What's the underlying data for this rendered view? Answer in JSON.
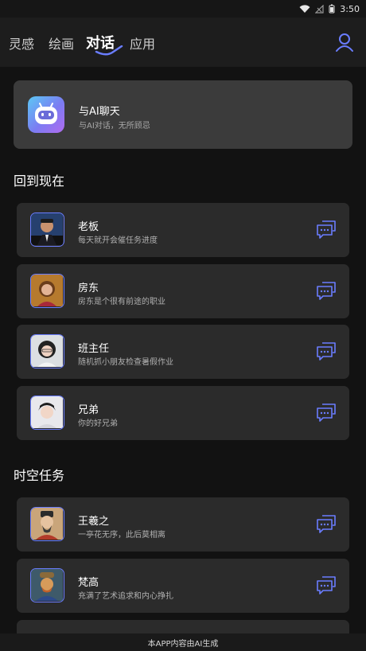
{
  "status_bar": {
    "time": "3:50"
  },
  "nav": {
    "tabs": [
      {
        "label": "灵感"
      },
      {
        "label": "绘画"
      },
      {
        "label": "对话"
      },
      {
        "label": "应用"
      }
    ],
    "active_tab": "对话"
  },
  "hero": {
    "title": "与AI聊天",
    "subtitle": "与AI对话，无所顾忌"
  },
  "sections": [
    {
      "title": "回到现在",
      "items": [
        {
          "name": "老板",
          "desc": "每天就开会催任务进度",
          "avatar": "businessman-portrait"
        },
        {
          "name": "房东",
          "desc": "房东是个很有前途的职业",
          "avatar": "woman-portrait"
        },
        {
          "name": "班主任",
          "desc": "随机抓小朋友检查暑假作业",
          "avatar": "teacher-portrait"
        },
        {
          "name": "兄弟",
          "desc": "你的好兄弟",
          "avatar": "young-man-portrait"
        }
      ]
    },
    {
      "title": "时空任务",
      "items": [
        {
          "name": "王羲之",
          "desc": "一亭花无序，此后莫相离",
          "avatar": "ancient-calligrapher-portrait"
        },
        {
          "name": "梵高",
          "desc": "充满了艺术追求和内心挣扎",
          "avatar": "van-gogh-portrait"
        }
      ]
    }
  ],
  "footer": {
    "text": "本APP内容由AI生成"
  },
  "colors": {
    "accent": "#6a7dff",
    "card": "#2b2b2b",
    "hero": "#3b3b3b",
    "background": "#121212"
  }
}
